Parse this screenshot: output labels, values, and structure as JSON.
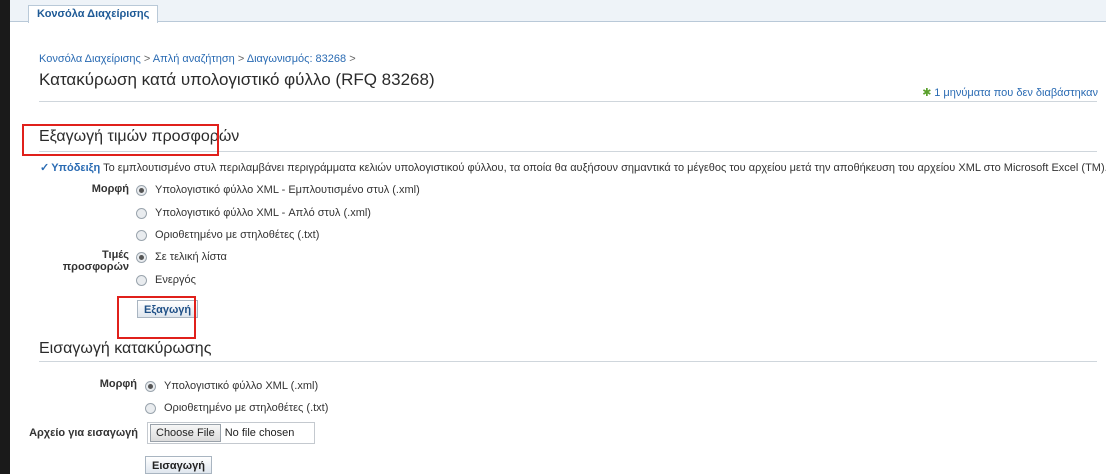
{
  "tab": {
    "label": "Κονσόλα Διαχείρισης"
  },
  "breadcrumb": {
    "items": [
      "Κονσόλα Διαχείρισης",
      "Απλή αναζήτηση",
      "Διαγωνισμός: 83268"
    ],
    "separator": ">"
  },
  "page": {
    "title": "Κατακύρωση κατά υπολογιστικό φύλλο (RFQ 83268)"
  },
  "messages": {
    "text": "1 μηνύματα που δεν διαβάστηκαν",
    "icon": "star-icon"
  },
  "export_section": {
    "title": "Εξαγωγή τιμών προσφορών",
    "hint_label": "Υπόδειξη",
    "hint_text": "Το εμπλουτισμένο στυλ περιλαμβάνει περιγράμματα κελιών υπολογιστικού φύλλου, τα οποία θα αυξήσουν σημαντικά το μέγεθος του αρχείου μετά την αποθήκευση του αρχείου XML στο Microsoft Excel (TM).",
    "format_label": "Μορφή",
    "format_options": [
      {
        "label": "Υπολογιστικό φύλλο XML - Εμπλουτισμένο στυλ (.xml)",
        "checked": true
      },
      {
        "label": "Υπολογιστικό φύλλο XML - Απλό στυλ (.xml)",
        "checked": false
      },
      {
        "label": "Οριοθετημένο με στηλοθέτες (.txt)",
        "checked": false
      }
    ],
    "prices_label": "Τιμές προσφορών",
    "prices_options": [
      {
        "label": "Σε τελική λίστα",
        "checked": true
      },
      {
        "label": "Ενεργός",
        "checked": false
      }
    ],
    "export_button": "Εξαγωγή"
  },
  "import_section": {
    "title": "Εισαγωγή κατακύρωσης",
    "format_label": "Μορφή",
    "format_options": [
      {
        "label": "Υπολογιστικό φύλλο XML (.xml)",
        "checked": true
      },
      {
        "label": "Οριοθετημένο με στηλοθέτες (.txt)",
        "checked": false
      }
    ],
    "file_label": "Αρχείο για εισαγωγή",
    "file_button": "Choose File",
    "file_status": "No file chosen",
    "import_button": "Εισαγωγή"
  },
  "colors": {
    "link": "#2a6bb3",
    "annotation": "#e0201b",
    "accent_green": "#5aa02c"
  }
}
